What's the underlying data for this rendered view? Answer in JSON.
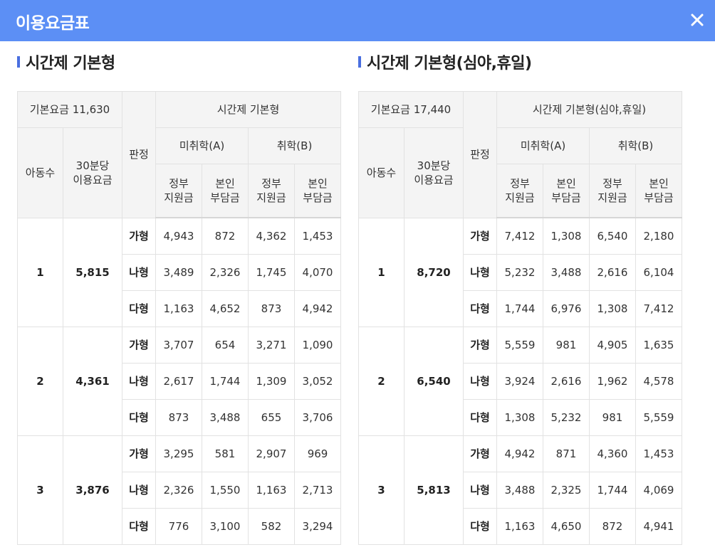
{
  "header": {
    "title": "이용요금표",
    "close_icon": "close-icon"
  },
  "tables": [
    {
      "section_title": "시간제 기본형",
      "base_fee_label": "기본요금 11,630",
      "group_header": "시간제 기본형",
      "children_label": "아동수",
      "rate_label_line1": "30분당",
      "rate_label_line2": "이용요금",
      "judgment_label": "판정",
      "col_a": "미취학(A)",
      "col_b": "취학(B)",
      "gov_line1": "정부",
      "gov_line2": "지원금",
      "self_line1": "본인",
      "self_line2": "부담금",
      "groups": [
        {
          "children": "1",
          "rate": "5,815",
          "rows": [
            {
              "type": "가형",
              "a_gov": "4,943",
              "a_self": "872",
              "b_gov": "4,362",
              "b_self": "1,453"
            },
            {
              "type": "나형",
              "a_gov": "3,489",
              "a_self": "2,326",
              "b_gov": "1,745",
              "b_self": "4,070"
            },
            {
              "type": "다형",
              "a_gov": "1,163",
              "a_self": "4,652",
              "b_gov": "873",
              "b_self": "4,942"
            }
          ]
        },
        {
          "children": "2",
          "rate": "4,361",
          "rows": [
            {
              "type": "가형",
              "a_gov": "3,707",
              "a_self": "654",
              "b_gov": "3,271",
              "b_self": "1,090"
            },
            {
              "type": "나형",
              "a_gov": "2,617",
              "a_self": "1,744",
              "b_gov": "1,309",
              "b_self": "3,052"
            },
            {
              "type": "다형",
              "a_gov": "873",
              "a_self": "3,488",
              "b_gov": "655",
              "b_self": "3,706"
            }
          ]
        },
        {
          "children": "3",
          "rate": "3,876",
          "rows": [
            {
              "type": "가형",
              "a_gov": "3,295",
              "a_self": "581",
              "b_gov": "2,907",
              "b_self": "969"
            },
            {
              "type": "나형",
              "a_gov": "2,326",
              "a_self": "1,550",
              "b_gov": "1,163",
              "b_self": "2,713"
            },
            {
              "type": "다형",
              "a_gov": "776",
              "a_self": "3,100",
              "b_gov": "582",
              "b_self": "3,294"
            }
          ]
        }
      ]
    },
    {
      "section_title": "시간제 기본형(심야,휴일)",
      "base_fee_label": "기본요금 17,440",
      "group_header": "시간제 기본형(심야,휴일)",
      "children_label": "아동수",
      "rate_label_line1": "30분당",
      "rate_label_line2": "이용요금",
      "judgment_label": "판정",
      "col_a": "미취학(A)",
      "col_b": "취학(B)",
      "gov_line1": "정부",
      "gov_line2": "지원금",
      "self_line1": "본인",
      "self_line2": "부담금",
      "groups": [
        {
          "children": "1",
          "rate": "8,720",
          "rows": [
            {
              "type": "가형",
              "a_gov": "7,412",
              "a_self": "1,308",
              "b_gov": "6,540",
              "b_self": "2,180"
            },
            {
              "type": "나형",
              "a_gov": "5,232",
              "a_self": "3,488",
              "b_gov": "2,616",
              "b_self": "6,104"
            },
            {
              "type": "다형",
              "a_gov": "1,744",
              "a_self": "6,976",
              "b_gov": "1,308",
              "b_self": "7,412"
            }
          ]
        },
        {
          "children": "2",
          "rate": "6,540",
          "rows": [
            {
              "type": "가형",
              "a_gov": "5,559",
              "a_self": "981",
              "b_gov": "4,905",
              "b_self": "1,635"
            },
            {
              "type": "나형",
              "a_gov": "3,924",
              "a_self": "2,616",
              "b_gov": "1,962",
              "b_self": "4,578"
            },
            {
              "type": "다형",
              "a_gov": "1,308",
              "a_self": "5,232",
              "b_gov": "981",
              "b_self": "5,559"
            }
          ]
        },
        {
          "children": "3",
          "rate": "5,813",
          "rows": [
            {
              "type": "가형",
              "a_gov": "4,942",
              "a_self": "871",
              "b_gov": "4,360",
              "b_self": "1,453"
            },
            {
              "type": "나형",
              "a_gov": "3,488",
              "a_self": "2,325",
              "b_gov": "1,744",
              "b_self": "4,069"
            },
            {
              "type": "다형",
              "a_gov": "1,163",
              "a_self": "4,650",
              "b_gov": "872",
              "b_self": "4,941"
            }
          ]
        }
      ]
    }
  ]
}
